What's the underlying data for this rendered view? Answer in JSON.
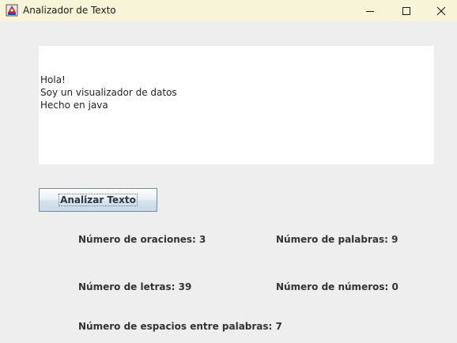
{
  "window": {
    "title": "Analizador de Texto",
    "icon": "java-app-icon",
    "titlebar_color": "#f7f4d7"
  },
  "editor": {
    "text": "Hola!\nSoy un visualizador de datos\nHecho en java"
  },
  "actions": {
    "analyze_label": "Analizar Texto"
  },
  "stats": {
    "oraciones": "Número de oraciones: 3",
    "palabras": "Número de palabras: 9",
    "letras": "Número de letras: 39",
    "numeros": "Número de números: 0",
    "espacios": "Número de espacios entre palabras: 7"
  }
}
